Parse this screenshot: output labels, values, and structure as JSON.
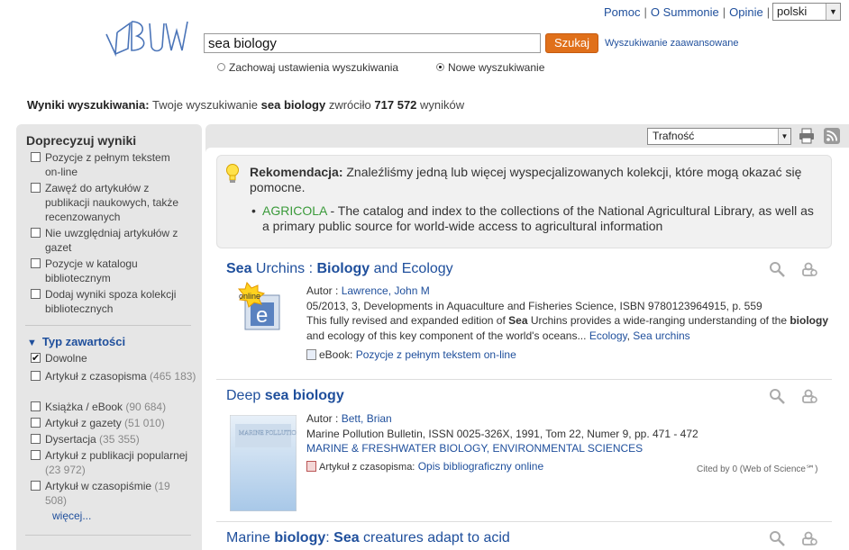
{
  "top_nav": {
    "links": [
      "Pomoc",
      "O Summonie",
      "Opinie"
    ],
    "language": "polski"
  },
  "search": {
    "query": "sea biology",
    "button_label": "Szukaj",
    "advanced_link": "Wyszukiwanie zaawansowane",
    "option_keep": "Zachowaj ustawienia wyszukiwania",
    "option_new": "Nowe wyszukiwanie",
    "selected_option": "Nowe wyszukiwanie"
  },
  "results_summary": {
    "label": "Wyniki wyszukiwania:",
    "prefix": "Twoje wyszukiwanie",
    "query": "sea biology",
    "middle": "zwróciło",
    "count": "717 572",
    "suffix": "wyników"
  },
  "sidebar": {
    "title": "Doprecyzuj wyniki",
    "refine_options": [
      {
        "label": "Pozycje z pełnym tekstem on-line",
        "checked": false
      },
      {
        "label": "Zawęź do artykułów z publikacji naukowych, także recenzowanych",
        "checked": false
      },
      {
        "label": "Nie uwzględniaj artykułów z gazet",
        "checked": false
      },
      {
        "label": "Pozycje w katalogu bibliotecznym",
        "checked": false
      },
      {
        "label": "Dodaj wyniki spoza kolekcji bibliotecznych",
        "checked": false
      }
    ],
    "content_type_title": "Typ zawartości",
    "content_types": [
      {
        "label": "Dowolne",
        "count": "",
        "checked": true
      },
      {
        "label": "Artykuł z czasopisma",
        "count": "(465 183)",
        "checked": false
      },
      {
        "label": "Książka / eBook",
        "count": "(90 684)",
        "checked": false
      },
      {
        "label": "Artykuł z gazety",
        "count": "(51 010)",
        "checked": false
      },
      {
        "label": "Dysertacja",
        "count": "(35 355)",
        "checked": false
      },
      {
        "label": "Artykuł z publikacji popularnej",
        "count": "(23 972)",
        "checked": false
      },
      {
        "label": "Artykuł w czasopiśmie",
        "count": "(19 508)",
        "checked": false
      }
    ],
    "more_label": "więcej..."
  },
  "sort": {
    "selected": "Trafność"
  },
  "recommendation": {
    "label": "Rekomendacja:",
    "text": "Znaleźliśmy jedną lub więcej wyspecjalizowanych kolekcji, które mogą okazać się pomocne.",
    "item_name": "AGRICOLA",
    "item_text": " - The catalog and index to the collections of the National Agricultural Library, as well as a primary public source for world-wide access to agricultural information"
  },
  "results": [
    {
      "title_parts": [
        "Sea",
        " Urchins : ",
        "Biology",
        " and Ecology"
      ],
      "cover_badge": "online",
      "author_label": "Autor : ",
      "author": "Lawrence, John M",
      "source": "05/2013, 3, Developments in Aquaculture and Fisheries Science, ISBN 9780123964915, p. 559",
      "snippet_parts": [
        "This fully revised and expanded edition of ",
        "Sea",
        " Urchins provides a wide-ranging understanding of the ",
        "biology",
        " and ecology of this key component of the world's oceans... "
      ],
      "subjects": [
        "Ecology",
        "Sea urchins"
      ],
      "format_label": "eBook:",
      "format_link": "Pozycje z pełnym tekstem on-line"
    },
    {
      "title_parts": [
        "Deep ",
        "sea biology"
      ],
      "cover_title": "MARINE POLLUTION BULLETIN",
      "author_label": "Autor : ",
      "author": "Bett, Brian",
      "source": "Marine Pollution Bulletin, ISSN 0025-326X, 1991, Tom 22, Numer 9, pp. 471 - 472",
      "subject_line": "MARINE & FRESHWATER BIOLOGY, ENVIRONMENTAL SCIENCES",
      "format_label": "Artykuł z czasopisma:",
      "format_link": "Opis bibliograficzny online",
      "cited": "Cited by 0 (Web of Science℠)"
    },
    {
      "title_parts": [
        "Marine ",
        "biology",
        ": ",
        "Sea",
        " creatures adapt to acid"
      ]
    }
  ]
}
